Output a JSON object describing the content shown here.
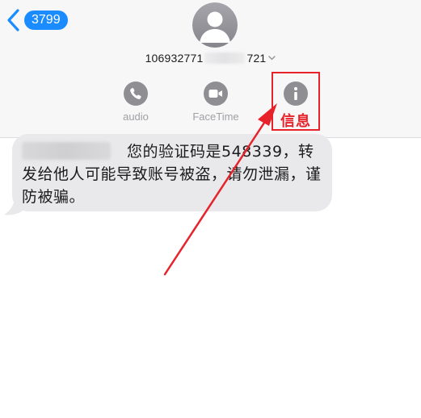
{
  "nav": {
    "back_count": "3799"
  },
  "contact": {
    "number_prefix": "106932771",
    "number_suffix": "721"
  },
  "actions": {
    "audio_label": "audio",
    "facetime_label": "FaceTime",
    "info_label": "信息"
  },
  "message": {
    "body": "您的验证码是548339，转发给他人可能导致账号被盗，请勿泄漏，谨防被骗。"
  },
  "colors": {
    "accent": "#1a8cff",
    "icon_gray": "#8e8e93",
    "highlight_red": "#e8222b",
    "bubble_gray": "#e9e9eb"
  },
  "icons": {
    "back": "chevron-left-icon",
    "avatar": "person-silhouette-icon",
    "audio": "phone-icon",
    "facetime": "video-camera-icon",
    "info": "info-icon"
  }
}
